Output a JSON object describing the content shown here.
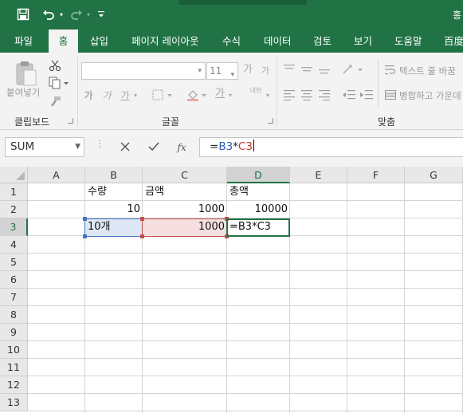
{
  "title_bar": {
    "save_icon": "save-icon",
    "undo_icon": "undo-icon",
    "redo_icon": "redo-icon",
    "customize_icon": "customize-quick-access-icon",
    "right_glyph": "홍"
  },
  "tabs": [
    {
      "label": "파일",
      "active": false
    },
    {
      "label": "홈",
      "active": true
    },
    {
      "label": "삽입",
      "active": false
    },
    {
      "label": "페이지 레이아웃",
      "active": false
    },
    {
      "label": "수식",
      "active": false
    },
    {
      "label": "데이터",
      "active": false
    },
    {
      "label": "검토",
      "active": false
    },
    {
      "label": "보기",
      "active": false
    },
    {
      "label": "도움말",
      "active": false
    },
    {
      "label": "百度",
      "active": false
    }
  ],
  "ribbon": {
    "clipboard": {
      "paste_label": "붙여넣기",
      "group_label": "클립보드"
    },
    "font": {
      "font_name": "",
      "font_size": "11",
      "increase_size": "가",
      "decrease_size": "가",
      "bold": "가",
      "italic": "가",
      "underline": "가",
      "font_color": "가",
      "phonetic": "내천",
      "group_label": "글꼴"
    },
    "alignment": {
      "wrap_text": "텍스트 줄 바꿈",
      "merge_center": "병합하고 가운데",
      "group_label": "맞춤"
    }
  },
  "formula_bar": {
    "name_box": "SUM",
    "cancel_icon": "cancel-icon",
    "enter_icon": "enter-icon",
    "function_icon": "fx",
    "formula_prefix": "=",
    "ref1": "B3",
    "op": "*",
    "ref2": "C3"
  },
  "sheet": {
    "columns": [
      "A",
      "B",
      "C",
      "D",
      "E",
      "F",
      "G"
    ],
    "rows": [
      "1",
      "2",
      "3",
      "4",
      "5",
      "6",
      "7",
      "8",
      "9",
      "10",
      "11",
      "12",
      "13"
    ],
    "selected_column": "D",
    "selected_row": "3",
    "cells": {
      "B1": "수량",
      "C1": "금액",
      "D1": "총액",
      "B2": "10",
      "C2": "1000",
      "D2": "10000",
      "B3": "10개",
      "C3": "1000",
      "D3": "=B3*C3"
    }
  },
  "colors": {
    "accent": "#217346",
    "ref_blue": "#4472c4",
    "ref_red": "#c0504d"
  }
}
